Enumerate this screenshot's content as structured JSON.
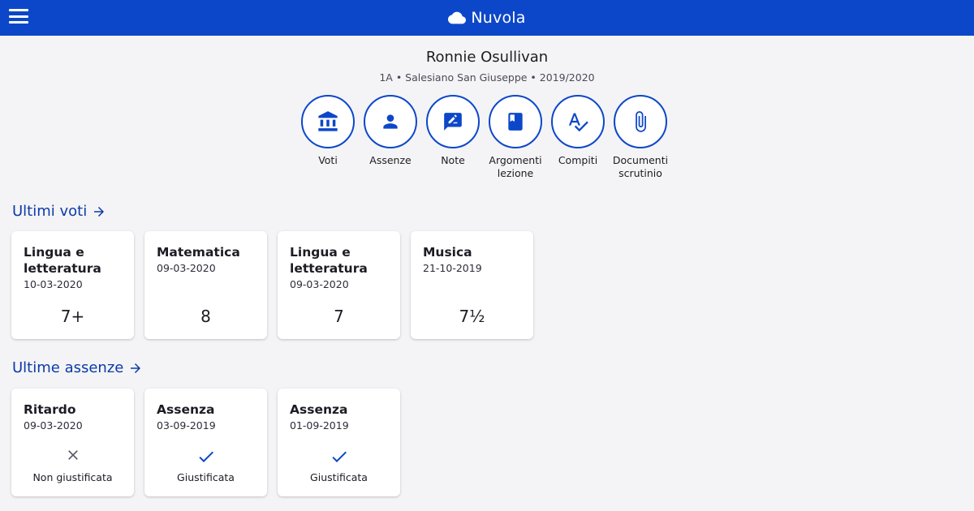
{
  "app": {
    "title": "Nuvola",
    "colors": {
      "primary": "#0d47c9",
      "link": "#0d3aa8",
      "background": "#f4f4f6"
    }
  },
  "header": {
    "menu_icon": "hamburger-menu-icon",
    "logo_icon": "cloud-icon"
  },
  "student": {
    "name": "Ronnie Osullivan",
    "details": "1A • Salesiano San Giuseppe • 2019/2020"
  },
  "actions": [
    {
      "label": "Voti",
      "icon": "bank-icon"
    },
    {
      "label": "Assenze",
      "icon": "person-icon"
    },
    {
      "label": "Note",
      "icon": "note-edit-icon"
    },
    {
      "label": "Argomenti\nlezione",
      "icon": "book-icon"
    },
    {
      "label": "Compiti",
      "icon": "spellcheck-icon"
    },
    {
      "label": "Documenti\nscrutinio",
      "icon": "paperclip-icon"
    }
  ],
  "grades": {
    "title": "Ultimi voti",
    "items": [
      {
        "subject": "Lingua e letteratura it...",
        "date": "10-03-2020",
        "grade": "7+"
      },
      {
        "subject": "Matematica",
        "date": "09-03-2020",
        "grade": "8"
      },
      {
        "subject": "Lingua e letteratura it...",
        "date": "09-03-2020",
        "grade": "7"
      },
      {
        "subject": "Musica",
        "date": "21-10-2019",
        "grade": "7½"
      }
    ]
  },
  "absences": {
    "title": "Ultime assenze",
    "items": [
      {
        "type": "Ritardo",
        "date": "09-03-2020",
        "status": "Non giustificata",
        "icon": "close-icon",
        "color": "#5a5a66"
      },
      {
        "type": "Assenza",
        "date": "03-09-2019",
        "status": "Giustificata",
        "icon": "check-icon",
        "color": "#0d47c9"
      },
      {
        "type": "Assenza",
        "date": "01-09-2019",
        "status": "Giustificata",
        "icon": "check-icon",
        "color": "#0d47c9"
      }
    ]
  }
}
